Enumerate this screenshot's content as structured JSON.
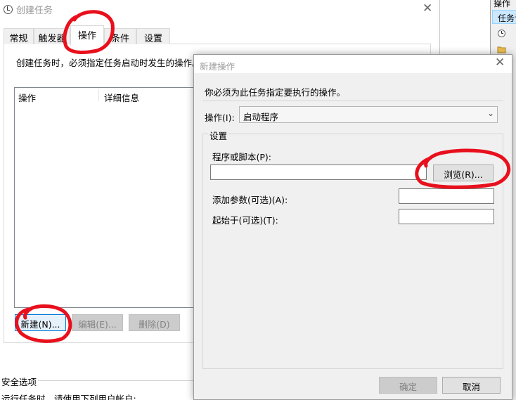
{
  "background_window": {
    "header": "操作",
    "selected_item": "任务计"
  },
  "create_task_dialog": {
    "title": "创建任务",
    "close_glyph": "✕",
    "tabs": [
      {
        "label": "常规",
        "active": false
      },
      {
        "label": "触发器",
        "active": false
      },
      {
        "label": "操作",
        "active": true
      },
      {
        "label": "条件",
        "active": false
      },
      {
        "label": "设置",
        "active": false
      }
    ],
    "description": "创建任务时，必须指定任务启动时发生的操作。",
    "columns": [
      "操作",
      "详细信息"
    ],
    "buttons": {
      "new": "新建(N)...",
      "edit": "编辑(E)...",
      "delete": "删除(D)"
    },
    "security_options": "安全选项",
    "security_sub": "运行任务时，请使用下列用户帐户:"
  },
  "new_action_dialog": {
    "title": "新建操作",
    "close_glyph": "✕",
    "description": "你必须为此任务指定要执行的操作。",
    "action_label": "操作(I):",
    "action_value": "启动程序",
    "settings_group": "设置",
    "program_label": "程序或脚本(P):",
    "program_value": "",
    "browse_button": "浏览(R)...",
    "args_label": "添加参数(可选)(A):",
    "args_value": "",
    "start_in_label": "起始于(可选)(T):",
    "start_in_value": "",
    "ok_button": "确定",
    "cancel_button": "取消"
  },
  "colors": {
    "annotation": "#e8101c",
    "selection": "#cce8ff",
    "focus_border": "#0078d7"
  }
}
